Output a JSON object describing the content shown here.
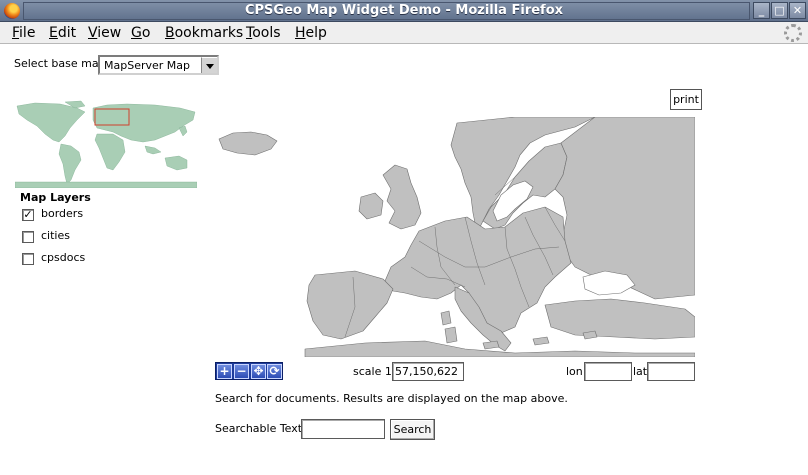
{
  "window": {
    "title": "CPSGeo Map Widget Demo - Mozilla Firefox",
    "buttons": [
      "_",
      "□",
      "✕"
    ]
  },
  "menu": [
    {
      "label": "File",
      "accel": "F",
      "rest": "ile"
    },
    {
      "label": "Edit",
      "accel": "E",
      "rest": "dit"
    },
    {
      "label": "View",
      "accel": "V",
      "rest": "iew"
    },
    {
      "label": "Go",
      "accel": "G",
      "rest": "o"
    },
    {
      "label": "Bookmarks",
      "accel": "B",
      "rest": "ookmarks"
    },
    {
      "label": "Tools",
      "accel": "T",
      "rest": "ools"
    },
    {
      "label": "Help",
      "accel": "H",
      "rest": "elp"
    }
  ],
  "basemap": {
    "label": "Select base map",
    "selected": "MapServer Map"
  },
  "layers": {
    "title": "Map Layers",
    "items": [
      {
        "label": "borders",
        "checked": true
      },
      {
        "label": "cities",
        "checked": false
      },
      {
        "label": "cpsdocs",
        "checked": false
      }
    ]
  },
  "print_label": "print",
  "nav_tools": {
    "zoom_in": "+",
    "zoom_out": "−",
    "pan": "✥",
    "full_extent": "⟳"
  },
  "scale": {
    "label": "scale 1:",
    "value": "57,150,622"
  },
  "coords": {
    "lon_label": "lon:",
    "lat_label": "lat:",
    "lon_value": "",
    "lat_value": ""
  },
  "search": {
    "note": "Search for documents. Results are displayed on the map above.",
    "label": "Searchable Text:",
    "value": "",
    "button": "Search"
  },
  "colors": {
    "land": "#c0c0c0",
    "land_border": "#6f6f6f",
    "overview_land": "#a9ceb5",
    "overview_highlight": "#d0402c",
    "titlebar": "#6f7f99"
  }
}
